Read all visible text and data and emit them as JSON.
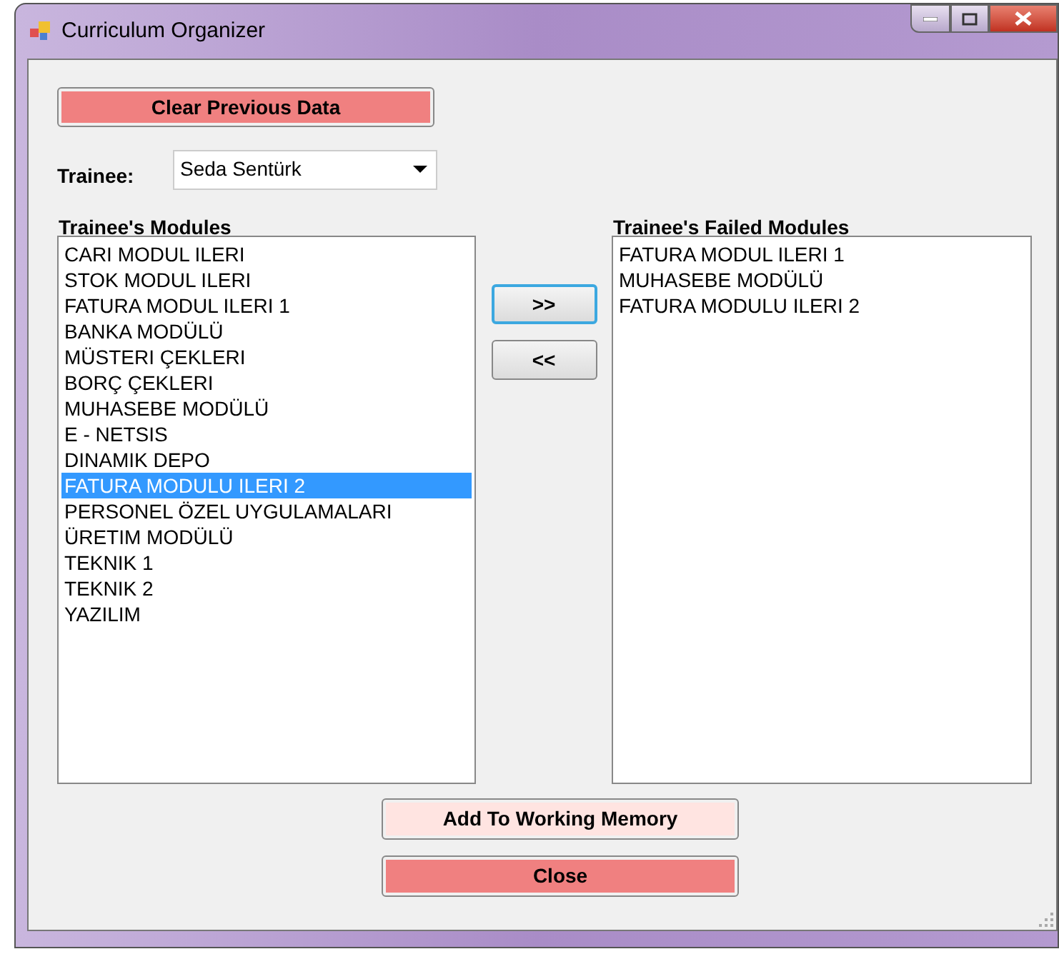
{
  "window": {
    "title": "Curriculum Organizer"
  },
  "clear_button": {
    "label": "Clear Previous Data",
    "kind": "alert"
  },
  "trainee": {
    "label": "Trainee:",
    "value": "Seda Sentürk"
  },
  "modules": {
    "label": "Trainee's Modules",
    "items": [
      {
        "text": "CARI MODUL ILERI",
        "selected": false
      },
      {
        "text": "STOK MODUL ILERI",
        "selected": false
      },
      {
        "text": "FATURA MODUL ILERI 1",
        "selected": false
      },
      {
        "text": "BANKA MODÜLÜ",
        "selected": false
      },
      {
        "text": "MÜSTERI ÇEKLERI",
        "selected": false
      },
      {
        "text": "BORÇ ÇEKLERI",
        "selected": false
      },
      {
        "text": "MUHASEBE MODÜLÜ",
        "selected": false
      },
      {
        "text": "E - NETSIS",
        "selected": false
      },
      {
        "text": "DINAMIK DEPO",
        "selected": false
      },
      {
        "text": "FATURA MODULU ILERI  2",
        "selected": true
      },
      {
        "text": "PERSONEL ÖZEL UYGULAMALARI",
        "selected": false
      },
      {
        "text": "ÜRETIM MODÜLÜ",
        "selected": false
      },
      {
        "text": "TEKNIK  1",
        "selected": false
      },
      {
        "text": "TEKNIK  2",
        "selected": false
      },
      {
        "text": "YAZILIM",
        "selected": false
      }
    ]
  },
  "move_buttons": [
    {
      "label": ">>",
      "focused": true
    },
    {
      "label": "<<",
      "focused": false
    }
  ],
  "failed_modules": {
    "label": "Trainee's Failed Modules",
    "items": [
      {
        "text": "FATURA MODUL ILERI 1",
        "selected": false
      },
      {
        "text": "MUHASEBE MODÜLÜ",
        "selected": false
      },
      {
        "text": "FATURA MODULU ILERI  2",
        "selected": false
      }
    ]
  },
  "bottom_buttons": [
    {
      "label": "Add To Working Memory",
      "kind": "soft"
    },
    {
      "label": "Close",
      "kind": "alert"
    }
  ]
}
